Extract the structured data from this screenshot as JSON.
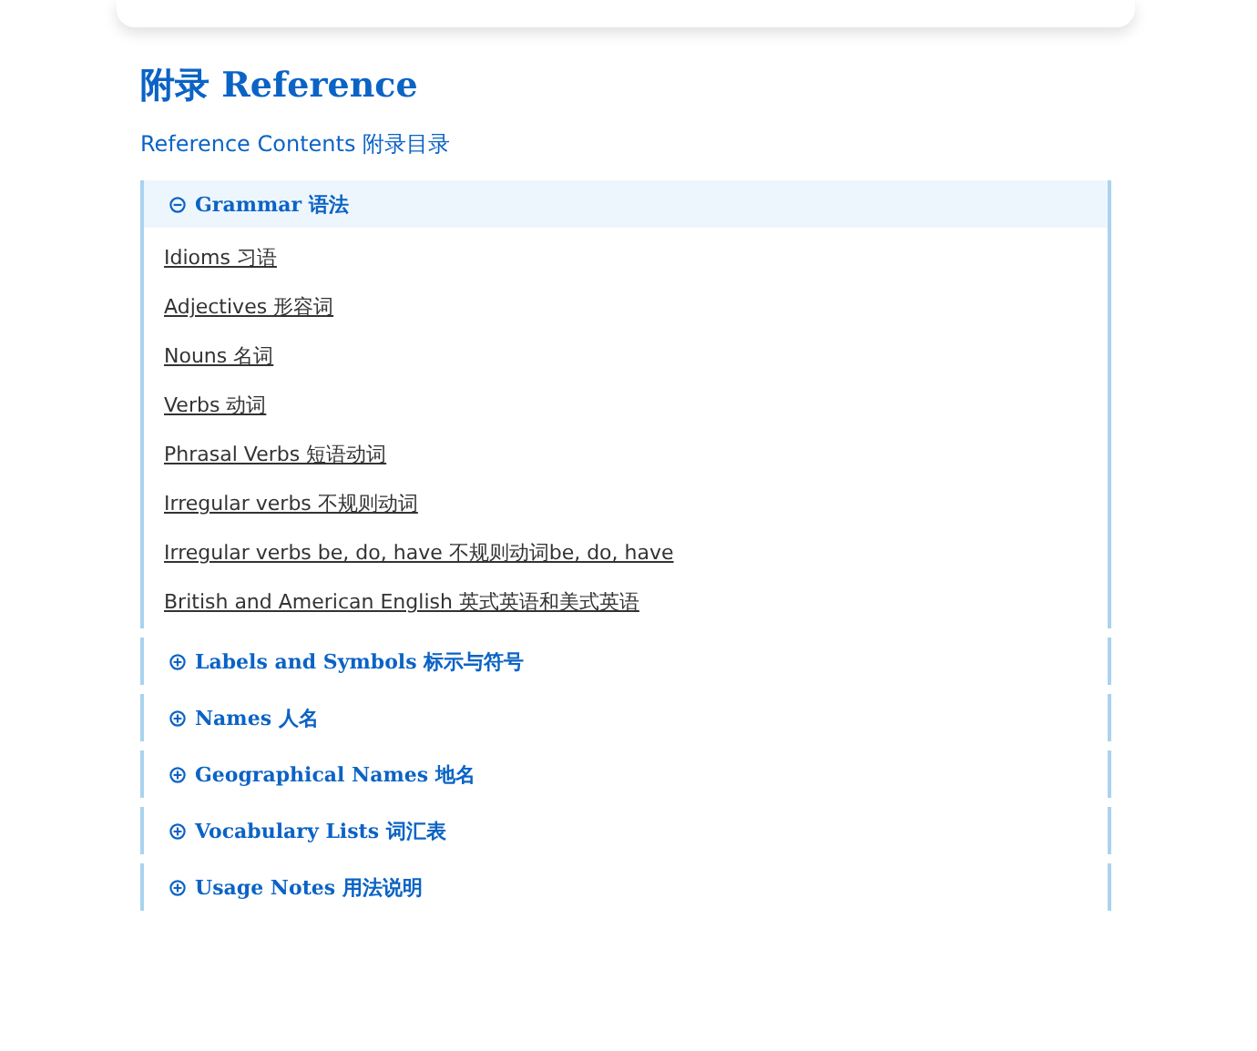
{
  "title": "附录 Reference",
  "subtitle": "Reference Contents 附录目录",
  "sections": [
    {
      "label": "Grammar 语法",
      "expanded": true,
      "items": [
        "Idioms 习语",
        "Adjectives 形容词",
        "Nouns 名词",
        "Verbs 动词",
        "Phrasal Verbs 短语动词",
        "Irregular verbs 不规则动词",
        "Irregular verbs be, do, have 不规则动词be, do, have",
        "British and American English 英式英语和美式英语"
      ]
    },
    {
      "label": "Labels and Symbols 标示与符号",
      "expanded": false
    },
    {
      "label": "Names 人名",
      "expanded": false
    },
    {
      "label": "Geographical Names 地名",
      "expanded": false
    },
    {
      "label": "Vocabulary Lists 词汇表",
      "expanded": false
    },
    {
      "label": "Usage Notes 用法说明",
      "expanded": false
    }
  ]
}
